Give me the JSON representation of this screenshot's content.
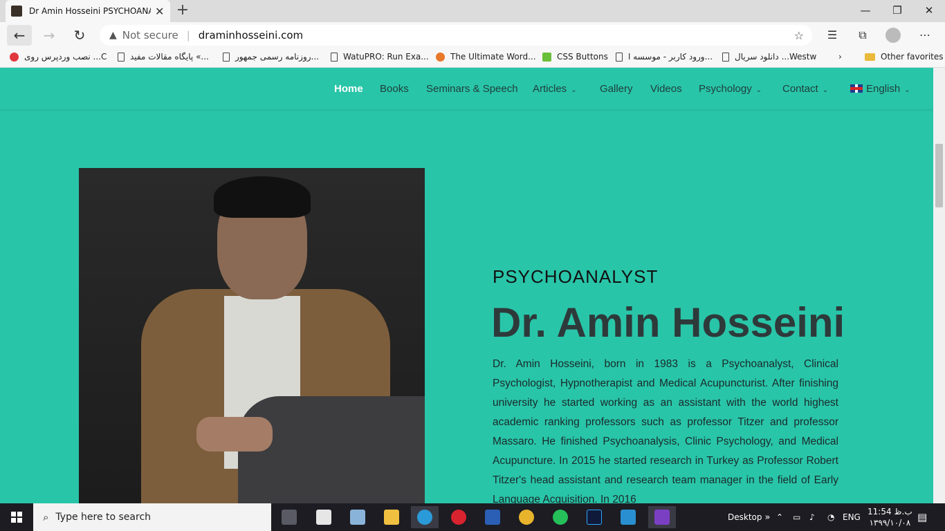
{
  "browser": {
    "tab_title": "Dr Amin Hosseini PSYCHOANALYST",
    "tab_close": "✕",
    "new_tab": "+",
    "window_controls": [
      "—",
      "❐",
      "✕"
    ],
    "security_label": "Not secure",
    "url": "draminhosseini.com",
    "favorites": [
      {
        "label": "نصب وردپرس روی ...C",
        "icon": "vivaldi-icon"
      },
      {
        "label": "پایگاه مقالات مفید «...",
        "icon": "document-icon"
      },
      {
        "label": "روزنامه رسمی جمهور...",
        "icon": "document-icon"
      },
      {
        "label": "WatuPRO: Run Exa...",
        "icon": "document-icon"
      },
      {
        "label": "The Ultimate Word...",
        "icon": "owl-icon"
      },
      {
        "label": "CSS Buttons",
        "icon": "css-icon"
      },
      {
        "label": "ورود کاربر - موسسه ا...",
        "icon": "document-icon"
      },
      {
        "label": "دانلود سریال ...Westw",
        "icon": "document-icon"
      }
    ],
    "other_favorites": "Other favorites"
  },
  "site": {
    "nav": [
      {
        "label": "Home",
        "active": true,
        "dropdown": false
      },
      {
        "label": "Books",
        "active": false,
        "dropdown": false
      },
      {
        "label": "Seminars & Speech",
        "active": false,
        "dropdown": false
      },
      {
        "label": "Articles",
        "active": false,
        "dropdown": true
      },
      {
        "label": "Gallery",
        "active": false,
        "dropdown": false
      },
      {
        "label": "Videos",
        "active": false,
        "dropdown": false
      },
      {
        "label": "Psychology",
        "active": false,
        "dropdown": true
      },
      {
        "label": "Contact",
        "active": false,
        "dropdown": true
      },
      {
        "label": "English",
        "active": false,
        "dropdown": true
      }
    ],
    "hero": {
      "eyebrow": "PSYCHOANALYST",
      "name": "Dr. Amin Hosseini",
      "bio": "Dr. Amin Hosseini, born in 1983 is a Psychoanalyst, Clinical Psychologist, Hypnotherapist and Medical Acupuncturist. After finishing university he started working as an assistant with the world highest academic ranking professors such as professor Titzer and professor Massaro. He finished Psychoanalysis, Clinic Psychology, and Medical Acupuncture. In 2015 he started research in Turkey as Professor Robert Titzer's head assistant and research team manager in the field of Early Language Acquisition. In 2016"
    },
    "colors": {
      "background": "#29c5a9",
      "nav_text": "#1f3d3a",
      "heading": "#2e3a3a"
    }
  },
  "taskbar": {
    "search_placeholder": "Type here to search",
    "desktop_label": "Desktop",
    "desktop_chevron": "»",
    "language": "ENG",
    "time": "11:54 ب.ظ",
    "date": "۱۳۹۹/۱۰/۰۸"
  }
}
